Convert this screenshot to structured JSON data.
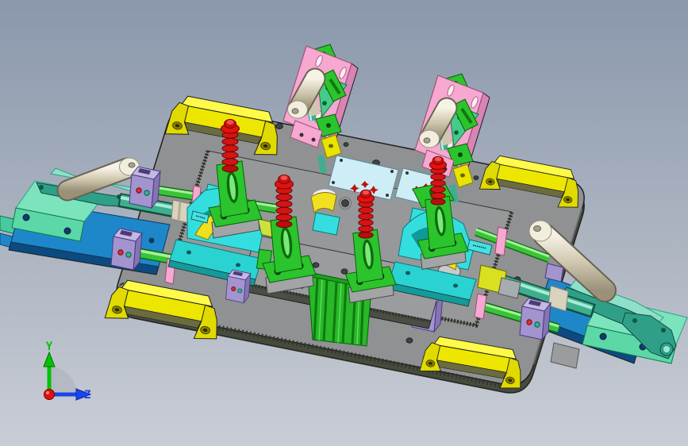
{
  "viewport": {
    "type": "cad-3d-viewport",
    "description": "Isometric shaded view of a welding/checking fixture assembly on a rectangular handling base plate",
    "background": {
      "top": "#8a98ac",
      "bottom": "#c9cdd6"
    },
    "axis_triad": {
      "origin_color": "#e01010",
      "arc_color": "#b2b7c1",
      "axes": [
        {
          "label": "Y",
          "color": "#00c400",
          "direction": "up"
        },
        {
          "label": "Z",
          "color": "#1a46e8",
          "direction": "right"
        }
      ]
    }
  },
  "palette": {
    "base_gray": "#8f9193",
    "base_edge": "#474b3e",
    "raised_gray": "#96989a",
    "platform_gray": "#9a9c9e",
    "handle_yellow": "#ede600",
    "handle_yellow_light": "#fff94a",
    "pink": "#f6a8d0",
    "pink_dark": "#d884b4",
    "mint": "#5cd8a8",
    "mint_light": "#7ce4bc",
    "teal_arm": "#2f9f88",
    "teal_arm_light": "#8fe0c8",
    "blue_plate": "#1e87c9",
    "blue_plate_dark": "#0c4a80",
    "beige": "#d9d2bd",
    "beige_light": "#f2eede",
    "beige_dark": "#6a6253",
    "teal_cyl": "#3fae8e",
    "green_rod": "#39c339",
    "green_rod_dark": "#0e6a0e",
    "green_rod_light": "#a6f09a",
    "bright_green": "#2cc42c",
    "green_dark": "#0c5c0c",
    "rib_green": "#28b828",
    "spring_red": "#d41414",
    "spring_red_dark": "#7a0000",
    "cyan": "#35dede",
    "cyan_dark": "#0f9a9a",
    "cyan_base": "#2ad2d2",
    "pale_blue": "#cdeef6",
    "workpiece_yellow": "#f0e020",
    "purple": "#a393cf",
    "purple_light": "#c4b8e4",
    "purple_dark": "#4a3a7a",
    "weld_mark_red": "#c01010"
  },
  "model": {
    "name": "fixture-assembly",
    "parts": [
      {
        "name": "base-plate",
        "count": 1,
        "color": "#8f9193"
      },
      {
        "name": "raised-fixture-plate",
        "count": 1,
        "color": "#96989a"
      },
      {
        "name": "lifting-handle",
        "count": 4,
        "color": "#ede600"
      },
      {
        "name": "vertical-toggle-clamp-station",
        "count": 2,
        "color": "#f6a8d0"
      },
      {
        "name": "horizontal-toggle-clamp",
        "count": 2,
        "color": "#5cd8a8"
      },
      {
        "name": "spring-plunger-clamp",
        "count": 4,
        "color": "#d41414"
      },
      {
        "name": "locating-saddle-block",
        "count": 2,
        "color": "#35dede"
      },
      {
        "name": "workpiece-section",
        "count": 3,
        "color": "#f0e020"
      },
      {
        "name": "guide-rod",
        "count": 4,
        "color": "#39c339"
      },
      {
        "name": "guide-block",
        "count": 6,
        "color": "#a393cf"
      },
      {
        "name": "ribbed-riser-block",
        "count": 1,
        "color": "#28b828"
      },
      {
        "name": "slide-plate",
        "count": 2,
        "color": "#1e87c9"
      },
      {
        "name": "id-tag",
        "count": 2,
        "color": "#49e0e0"
      }
    ]
  }
}
